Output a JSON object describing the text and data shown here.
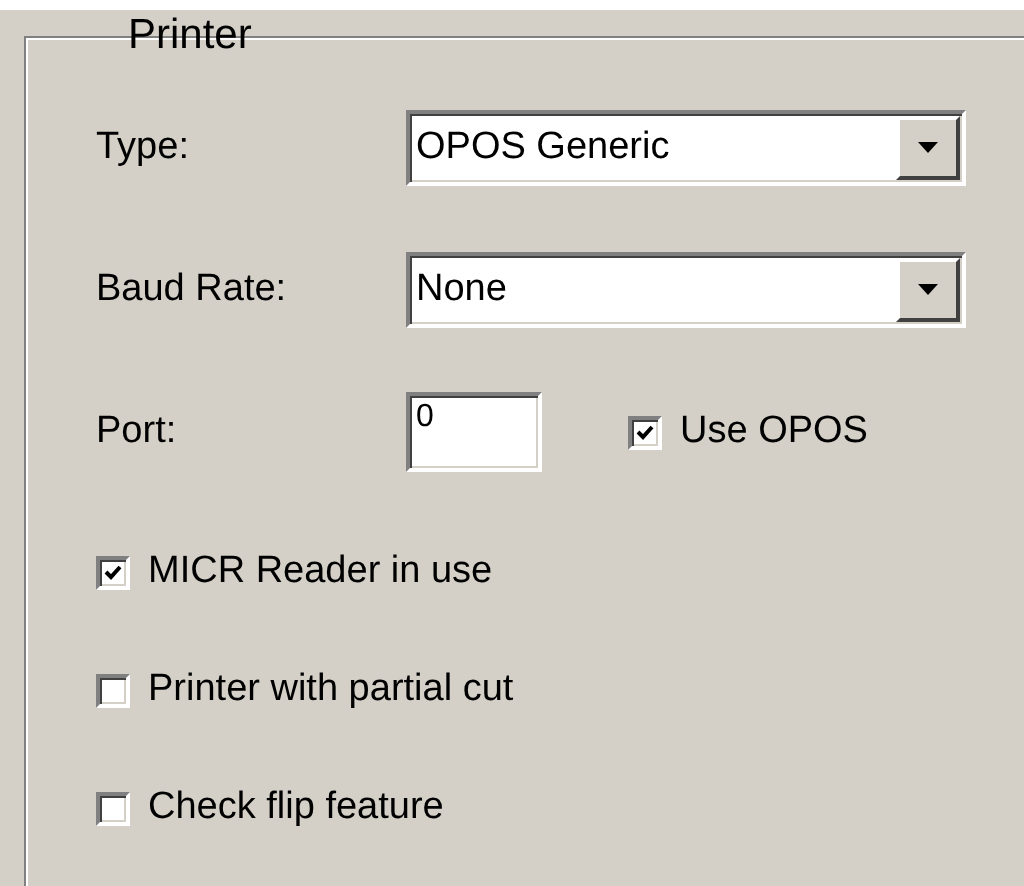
{
  "group": {
    "title": "Printer"
  },
  "fields": [
    {
      "kind": "combo",
      "label": "Type:",
      "value": "OPOS Generic"
    },
    {
      "kind": "combo",
      "label": "Baud Rate:",
      "value": "None"
    },
    {
      "kind": "text",
      "label": "Port:",
      "value": "0",
      "checkbox": {
        "label": "Use OPOS",
        "checked": true
      }
    }
  ],
  "options": [
    {
      "label": "MICR Reader in use",
      "checked": true
    },
    {
      "label": "Printer with partial cut",
      "checked": false
    },
    {
      "label": "Check flip feature",
      "checked": false
    }
  ]
}
